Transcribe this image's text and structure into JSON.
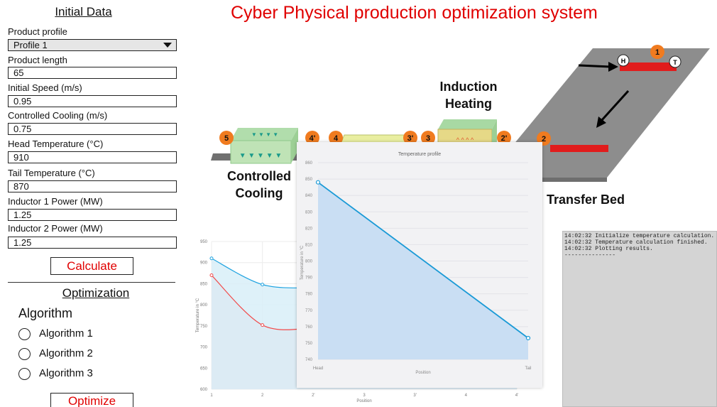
{
  "initial_data": {
    "heading": "Initial Data",
    "fields": [
      {
        "label": "Product profile",
        "value": "Profile 1"
      },
      {
        "label": "Product length",
        "value": "65"
      },
      {
        "label": "Initial Speed (m/s)",
        "value": "0.95"
      },
      {
        "label": "Controlled Cooling (m/s)",
        "value": "0.75"
      },
      {
        "label": "Head Temperature (°C)",
        "value": "910"
      },
      {
        "label": "Tail Temperature (°C)",
        "value": "870"
      },
      {
        "label": "Inductor 1 Power (MW)",
        "value": "1.25"
      },
      {
        "label": "Inductor 2 Power (MW)",
        "value": "1.25"
      }
    ],
    "calculate_label": "Calculate"
  },
  "optimization": {
    "heading": "Optimization",
    "algorithm_label": "Algorithm",
    "options": [
      "Algorithm 1",
      "Algorithm 2",
      "Algorithm 3"
    ],
    "optimize_label": "Optimize"
  },
  "title": "Cyber Physical production optimization system",
  "diagram": {
    "stations": {
      "controlled_cooling": "Controlled\nCooling",
      "induction_heating": "Induction\nHeating",
      "transfer_bed": "Transfer Bed"
    },
    "markers": [
      "1",
      "2",
      "2'",
      "3",
      "3'",
      "4",
      "4'",
      "5"
    ],
    "head_label": "H",
    "tail_label": "T"
  },
  "log": {
    "lines": [
      "14:02:32 Initialize temperature calculation.",
      "14:02:32 Temperature calculation finished.",
      "14:02:32 Plotting results.",
      "---------------"
    ]
  },
  "colors": {
    "accent_red": "#e00000",
    "marker_orange": "#f07b1f",
    "head_series": "#1fa3e0",
    "tail_series": "#f24a4a",
    "fg_line": "#1a9ad6",
    "fg_fill": "#c9def3"
  },
  "chart_data": [
    {
      "type": "area",
      "title": "",
      "xlabel": "Position",
      "ylabel": "Temperature in °C",
      "x": [
        "1",
        "2",
        "2'",
        "3",
        "3'",
        "4",
        "4'"
      ],
      "ylim": [
        600,
        950
      ],
      "yticks": [
        600,
        650,
        700,
        750,
        800,
        850,
        900,
        950
      ],
      "series": [
        {
          "values": [
            910,
            848,
            840,
            null,
            null,
            null,
            null
          ]
        },
        {
          "values": [
            870,
            752,
            745,
            null,
            null,
            null,
            null
          ]
        }
      ]
    },
    {
      "type": "area",
      "title": "Temperature profile",
      "xlabel": "Position",
      "ylabel": "Temperature in °C",
      "categories": [
        "Head",
        "Tail"
      ],
      "values": [
        848,
        753
      ],
      "ylim": [
        740,
        860
      ],
      "yticks": [
        740,
        750,
        760,
        770,
        780,
        790,
        800,
        810,
        820,
        830,
        840,
        850,
        860
      ]
    }
  ]
}
